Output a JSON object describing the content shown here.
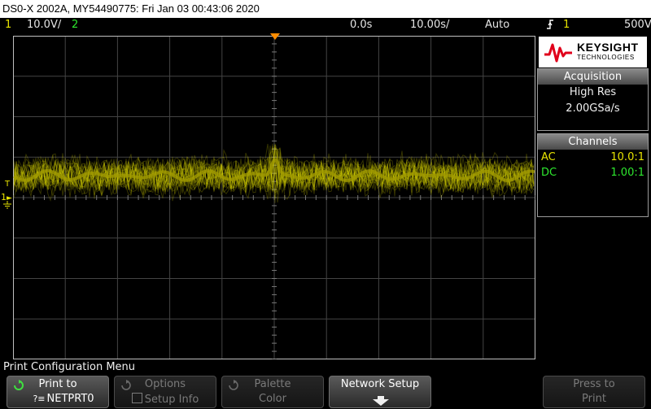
{
  "title": "DS0-X 2002A, MY54490775: Fri Jan 03 00:43:06 2020",
  "status": {
    "ch1_num": "1",
    "ch1_scale": "10.0V/",
    "ch2_num": "2",
    "time_offset": "0.0s",
    "time_scale": "10.00s/",
    "trigger_mode": "Auto",
    "trigger_channel": "1",
    "trigger_level": "500V"
  },
  "markers": {
    "trigger_level": "T",
    "ch1_ground": "1"
  },
  "brand": {
    "name": "KEYSIGHT",
    "sub": "TECHNOLOGIES"
  },
  "acquisition": {
    "header": "Acquisition",
    "mode": "High Res",
    "rate": "2.00GSa/s"
  },
  "channels": {
    "header": "Channels",
    "rows": [
      {
        "coupling": "AC",
        "probe": "10.0:1",
        "color": "#e8e400"
      },
      {
        "coupling": "DC",
        "probe": "1.00:1",
        "color": "#2ee82e"
      }
    ]
  },
  "menu_title": "Print Configuration Menu",
  "softkeys": {
    "print_to": {
      "line1": "Print to",
      "line2": "NETPRT0"
    },
    "options": {
      "line1": "Options",
      "line2": "Setup Info"
    },
    "palette": {
      "line1": "Palette",
      "line2": "Color"
    },
    "network": {
      "line1": "Network Setup"
    },
    "press_print": {
      "line1": "Press to",
      "line2": "Print"
    }
  },
  "colors": {
    "ch1": "#e8e400",
    "ch2": "#2ee82e",
    "trigger": "#ff8c00"
  }
}
